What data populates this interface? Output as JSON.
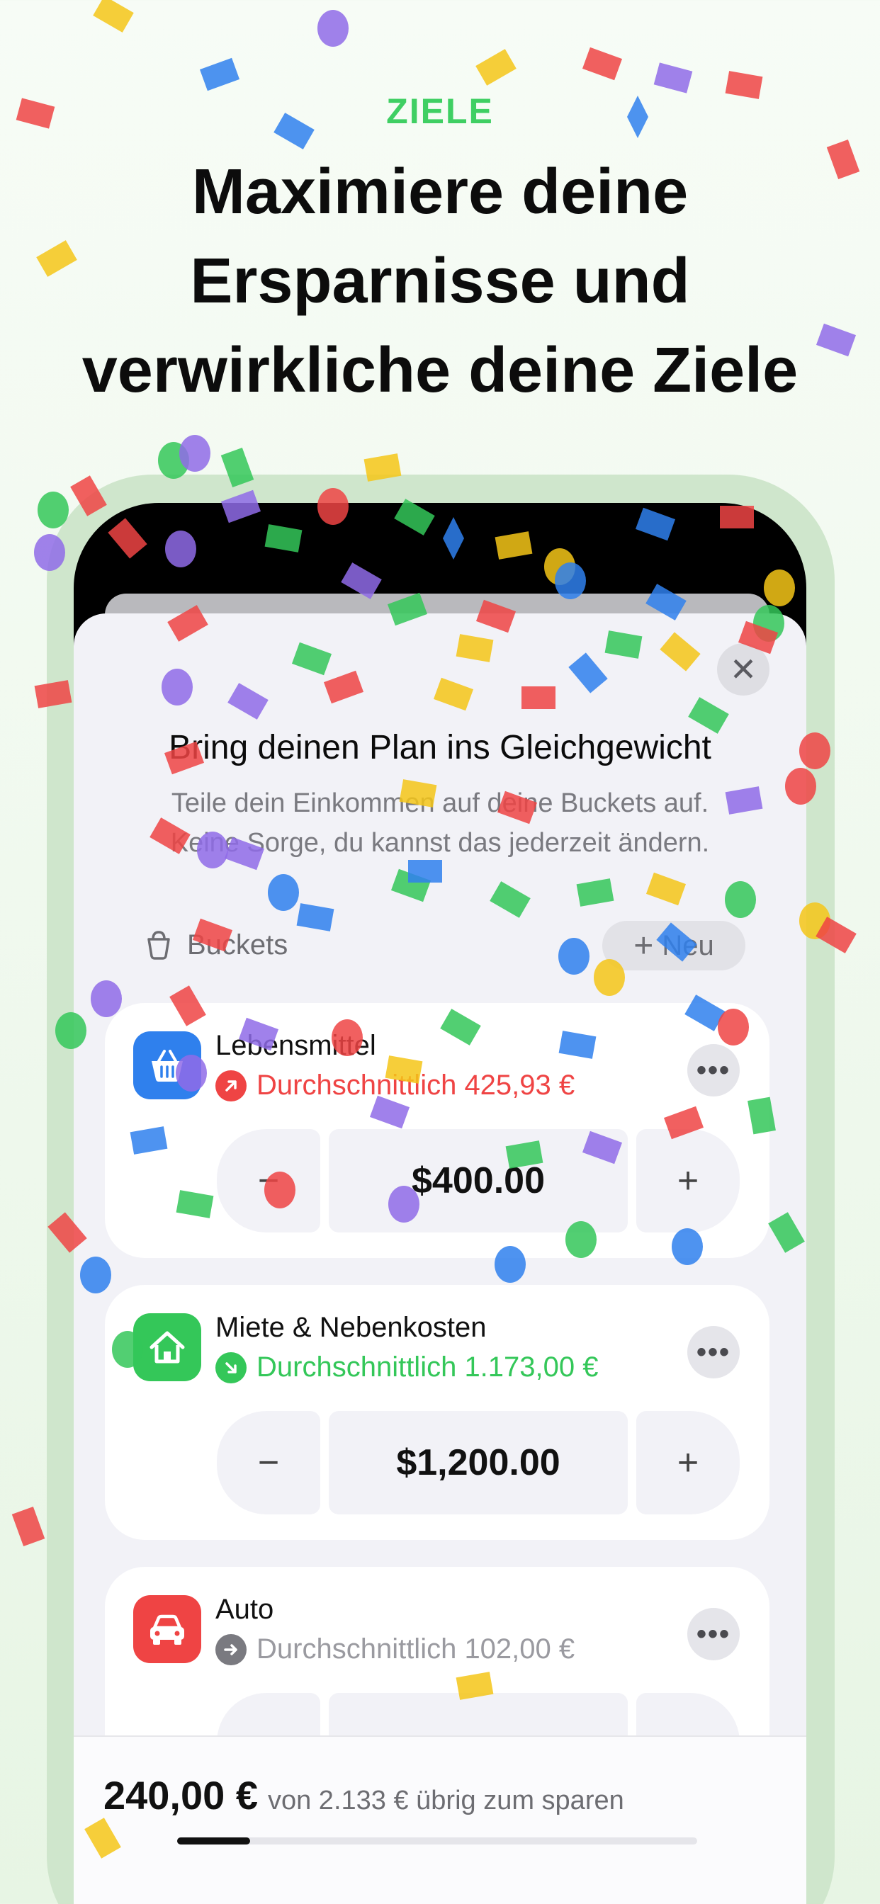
{
  "header": {
    "eyebrow": "ZIELE",
    "line1": "Maximiere deine",
    "line2": "Ersparnisse und",
    "line3": "verwirkliche deine Ziele"
  },
  "sheet": {
    "close_icon": "close-icon",
    "title": "Bring deinen Plan ins Gleichgewicht",
    "subtitle_line1": "Teile dein Einkommen auf deine Buckets auf.",
    "subtitle_line2": "Keine Sorge, du kannst das jederzeit ändern.",
    "buckets_label": "Buckets",
    "new_button": "Neu",
    "new_plus": "+"
  },
  "buckets": [
    {
      "name": "Lebensmittel",
      "icon": "basket-icon",
      "icon_color": "#2f80ed",
      "average": "Durchschnittlich 425,93 €",
      "trend": "up",
      "trend_color": "#ef4444",
      "amount": "$400.00",
      "minus": "−",
      "plus": "+",
      "more": "•••"
    },
    {
      "name": "Miete & Nebenkosten",
      "icon": "house-icon",
      "icon_color": "#34c759",
      "average": "Durchschnittlich 1.173,00 €",
      "trend": "down",
      "trend_color": "#34c759",
      "amount": "$1,200.00",
      "minus": "−",
      "plus": "+",
      "more": "•••"
    },
    {
      "name": "Auto",
      "icon": "car-icon",
      "icon_color": "#ef4444",
      "average": "Durchschnittlich 102,00 €",
      "trend": "flat",
      "trend_color": "#9a9aa0",
      "amount": "",
      "minus": "−",
      "plus": "+",
      "more": "•••"
    }
  ],
  "footer": {
    "amount": "240,00 €",
    "rest": "von 2.133 € übrig zum sparen",
    "progress": 0.14
  },
  "colors": {
    "accent_green": "#3fcf63",
    "red": "#ef4444",
    "blue": "#2f80ed"
  }
}
